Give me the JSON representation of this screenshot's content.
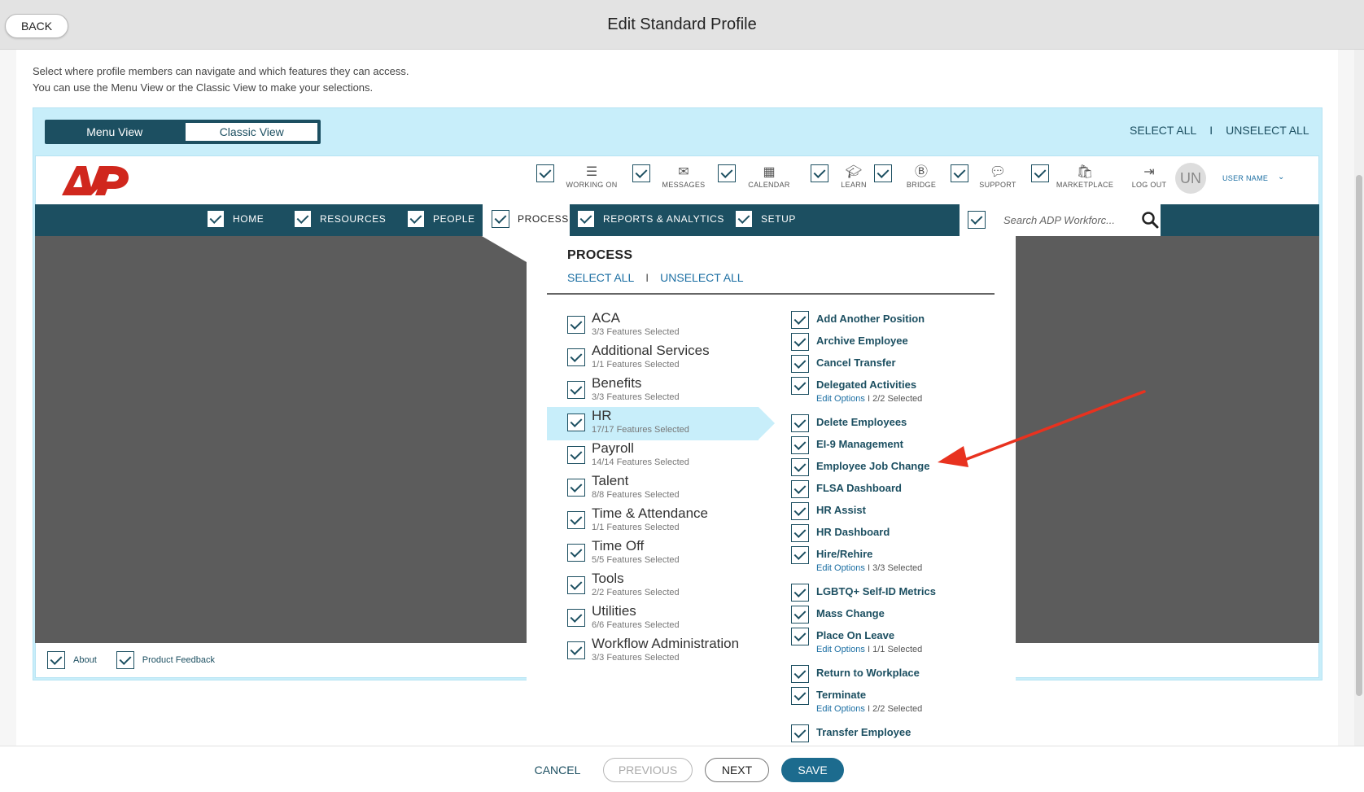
{
  "header": {
    "back_label": "BACK",
    "title": "Edit Standard Profile"
  },
  "description": {
    "line1": "Select where profile members can navigate and which features they can access.",
    "line2": "You can use the Menu View or the Classic View to make your selections."
  },
  "view_toggle": {
    "menu_view": "Menu View",
    "classic_view": "Classic View"
  },
  "panel_links": {
    "select_all": "SELECT ALL",
    "separator": "I",
    "unselect_all": "UNSELECT ALL"
  },
  "header_icons": [
    {
      "label": "WORKING ON",
      "icon": "list-icon"
    },
    {
      "label": "MESSAGES",
      "icon": "envelope-icon"
    },
    {
      "label": "CALENDAR",
      "icon": "calendar-icon"
    },
    {
      "label": "LEARN",
      "icon": "graduation-cap-icon"
    },
    {
      "label": "BRIDGE",
      "icon": "bridge-icon"
    },
    {
      "label": "SUPPORT",
      "icon": "chat-bubble-icon"
    },
    {
      "label": "MARKETPLACE",
      "icon": "bag-icon"
    },
    {
      "label": "LOG OUT",
      "icon": "logout-icon"
    }
  ],
  "user": {
    "initials": "UN",
    "name": "USER NAME"
  },
  "nav": {
    "items": [
      "HOME",
      "RESOURCES",
      "PEOPLE",
      "PROCESS",
      "REPORTS & ANALYTICS",
      "SETUP"
    ],
    "search_placeholder": "Search ADP Workforc..."
  },
  "footer_links": {
    "about": "About",
    "feedback": "Product Feedback"
  },
  "dropdown": {
    "title": "PROCESS",
    "select_all": "SELECT ALL",
    "separator": "I",
    "unselect_all": "UNSELECT ALL",
    "categories": [
      {
        "name": "ACA",
        "count": "3/3 Features Selected"
      },
      {
        "name": "Additional Services",
        "count": "1/1 Features Selected"
      },
      {
        "name": "Benefits",
        "count": "3/3 Features Selected"
      },
      {
        "name": "HR",
        "count": "17/17 Features Selected"
      },
      {
        "name": "Payroll",
        "count": "14/14 Features Selected"
      },
      {
        "name": "Talent",
        "count": "8/8 Features Selected"
      },
      {
        "name": "Time & Attendance",
        "count": "1/1 Features Selected"
      },
      {
        "name": "Time Off",
        "count": "5/5 Features Selected"
      },
      {
        "name": "Tools",
        "count": "2/2 Features Selected"
      },
      {
        "name": "Utilities",
        "count": "6/6 Features Selected"
      },
      {
        "name": "Workflow Administration",
        "count": "3/3 Features Selected"
      }
    ],
    "features": [
      {
        "name": "Add Another Position"
      },
      {
        "name": "Archive Employee"
      },
      {
        "name": "Cancel Transfer"
      },
      {
        "name": "Delegated Activities",
        "edit": "Edit Options",
        "selected": "2/2 Selected"
      },
      {
        "name": "Delete Employees"
      },
      {
        "name": "EI-9 Management"
      },
      {
        "name": "Employee Job Change"
      },
      {
        "name": "FLSA Dashboard"
      },
      {
        "name": "HR Assist"
      },
      {
        "name": "HR Dashboard"
      },
      {
        "name": "Hire/Rehire",
        "edit": "Edit Options",
        "selected": "3/3 Selected"
      },
      {
        "name": "LGBTQ+ Self-ID Metrics"
      },
      {
        "name": "Mass Change"
      },
      {
        "name": "Place On Leave",
        "edit": "Edit Options",
        "selected": "1/1 Selected"
      },
      {
        "name": "Return to Workplace"
      },
      {
        "name": "Terminate",
        "edit": "Edit Options",
        "selected": "2/2 Selected"
      },
      {
        "name": "Transfer Employee"
      }
    ],
    "sub_separator": "I"
  },
  "bottom": {
    "cancel": "CANCEL",
    "previous": "PREVIOUS",
    "next": "NEXT",
    "save": "SAVE"
  },
  "colors": {
    "brand_dark": "#1c4f61",
    "panel_blue": "#c8eefa",
    "save_blue": "#1c6b8e",
    "adp_red": "#d0271d",
    "arrow_red": "#e8321f"
  }
}
